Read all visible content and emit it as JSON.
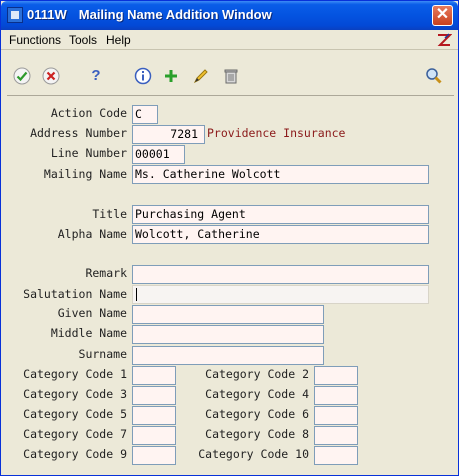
{
  "window": {
    "code": "0111W",
    "title": "Mailing Name Addition Window"
  },
  "menu": {
    "functions": "Functions",
    "tools": "Tools",
    "help": "Help"
  },
  "toolbar": {
    "ok_icon": "check-icon",
    "cancel_icon": "cancel-x-icon",
    "help_icon": "question-icon",
    "info_icon": "info-icon",
    "add_icon": "plus-icon",
    "edit_icon": "pencil-icon",
    "delete_icon": "trash-icon",
    "find_icon": "magnifier-icon",
    "help_glyph": "?",
    "info_glyph": "ℹ",
    "add_glyph": "+"
  },
  "form": {
    "action_code": {
      "label": "Action Code",
      "value": "C"
    },
    "address_number": {
      "label": "Address Number",
      "value": "7281",
      "description": "Providence Insurance"
    },
    "line_number": {
      "label": "Line Number",
      "value": "00001"
    },
    "mailing_name": {
      "label": "Mailing Name",
      "value": "Ms. Catherine Wolcott"
    },
    "title": {
      "label": "Title",
      "value": "Purchasing Agent"
    },
    "alpha_name": {
      "label": "Alpha Name",
      "value": "Wolcott, Catherine"
    },
    "remark": {
      "label": "Remark",
      "value": ""
    },
    "salutation_name": {
      "label": "Salutation Name",
      "value": ""
    },
    "given_name": {
      "label": "Given Name",
      "value": ""
    },
    "middle_name": {
      "label": "Middle Name",
      "value": ""
    },
    "surname": {
      "label": "Surname",
      "value": ""
    },
    "category_codes": [
      {
        "label": "Category Code 1",
        "value": ""
      },
      {
        "label": "Category Code 2",
        "value": ""
      },
      {
        "label": "Category Code 3",
        "value": ""
      },
      {
        "label": "Category Code 4",
        "value": ""
      },
      {
        "label": "Category Code 5",
        "value": ""
      },
      {
        "label": "Category Code 6",
        "value": ""
      },
      {
        "label": "Category Code 7",
        "value": ""
      },
      {
        "label": "Category Code 8",
        "value": ""
      },
      {
        "label": "Category Code 9",
        "value": ""
      },
      {
        "label": "Category Code 10",
        "value": ""
      }
    ]
  },
  "colors": {
    "field_bg": "#fff4f2",
    "description_text": "#8b1a1a",
    "titlebar": "#0453e0"
  }
}
